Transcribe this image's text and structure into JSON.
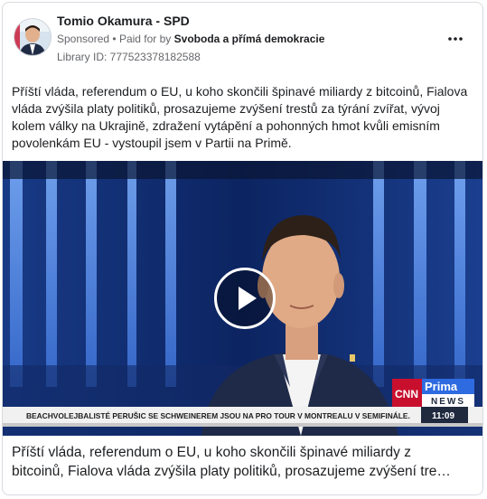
{
  "post": {
    "page_name": "Tomio Okamura - SPD",
    "sponsored": "Sponsored",
    "dot": "•",
    "paid_for_by": "Paid for by",
    "sponsor": "Svoboda a přímá demokracie",
    "library_id": "Library ID: 777523378182588",
    "body": "Příští vláda, referendum o EU, u koho skončili špinavé miliardy z bitcoinů, Fialova vláda zvýšila platy politiků, prosazujeme zvýšení trestů za týrání zvířat, vývoj kolem války na Ukrajině, zdražení vytápění a pohonných hmot kvůli emisním povolenkám EU - vystoupil jsem v Partii na Primě.",
    "more_icon": "more-horizontal-icon",
    "play_icon": "play-icon"
  },
  "video": {
    "ticker": "BEACHVOLEJBALISTÉ PERUŠIC SE SCHWEINEREM JSOU NA PRO TOUR V MONTREALU V SEMIFINÁLE.",
    "time": "11:09",
    "cnn": "CNN",
    "prima": "Prima",
    "news": "NEWS"
  },
  "caption": {
    "line1": "Příští vláda, referendum o EU, u koho skončili špinavé miliardy z",
    "line2": "bitcoinů, Fialova vláda zvýšila platy politiků, prosazujeme zvýšení tre…"
  },
  "colors": {
    "accent": "#c8102e",
    "text": "#1c1e21",
    "muted": "#65676b"
  }
}
